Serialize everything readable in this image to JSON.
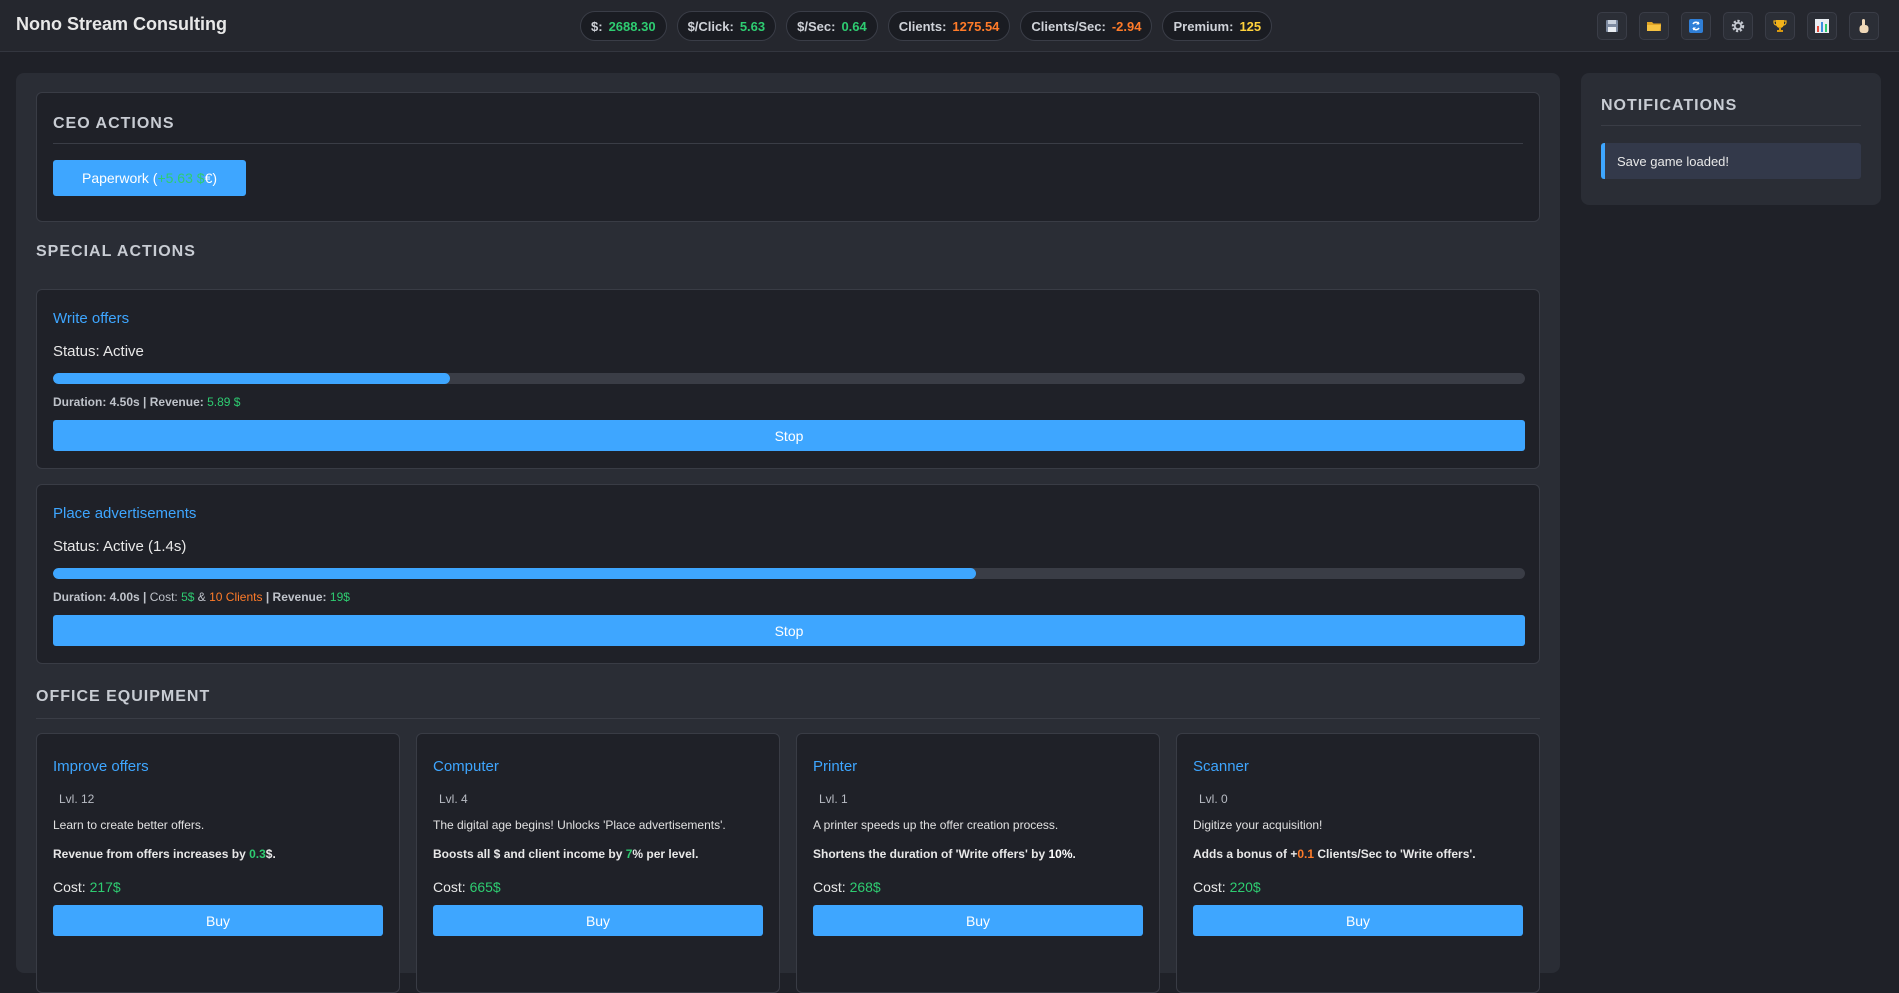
{
  "app": {
    "title": "Nono Stream Consulting"
  },
  "stats": [
    {
      "label": "$:",
      "value": "2688.30",
      "color": "#2ecc71"
    },
    {
      "label": "$/Click:",
      "value": "5.63",
      "color": "#2ecc71"
    },
    {
      "label": "$/Sec:",
      "value": "0.64",
      "color": "#2ecc71"
    },
    {
      "label": "Clients:",
      "value": "1275.54",
      "color": "#ff7b29"
    },
    {
      "label": "Clients/Sec:",
      "value": "-2.94",
      "color": "#ff7b29"
    },
    {
      "label": "Premium:",
      "value": "125",
      "color": "#ffd23c"
    }
  ],
  "toolbar": {
    "icons": [
      "save-icon",
      "load-folder-icon",
      "reset-icon",
      "settings-gear-icon",
      "trophy-icon",
      "stats-chart-icon",
      "pointer-hand-icon"
    ]
  },
  "ceo": {
    "title": "CEO ACTIONS",
    "paperwork_prefix": "Paperwork (",
    "paperwork_value": "+5.63 $",
    "paperwork_suffix": " €)"
  },
  "special": {
    "title": "SPECIAL ACTIONS",
    "actions": [
      {
        "name": "Write offers",
        "status": "Status: Active",
        "progress": 0.27,
        "duration_label": "Duration:",
        "duration": "4.50s",
        "sep": " | ",
        "revenue_label": "Revenue:",
        "revenue": "5.89 $",
        "button": "Stop"
      },
      {
        "name": "Place advertisements",
        "status": "Status: Active (1.4s)",
        "progress": 0.627,
        "duration_label": "Duration:",
        "duration": "4.00s",
        "sep": " | ",
        "cost_label": "Cost:",
        "cost_money": "5$",
        "amp": " & ",
        "cost_clients": "10 Clients",
        "sep2": " | ",
        "revenue_label": "Revenue:",
        "revenue": "19$",
        "button": "Stop"
      }
    ]
  },
  "office": {
    "title": "OFFICE EQUIPMENT",
    "items": [
      {
        "name": "Improve offers",
        "level": "Lvl. 12",
        "desc": "Learn to create better offers.",
        "effect_pre": "Revenue from offers increases by ",
        "effect_val": "0.3",
        "effect_post": "$.",
        "cost_label": "Cost: ",
        "cost": "217$",
        "button": "Buy"
      },
      {
        "name": "Computer",
        "level": "Lvl. 4",
        "desc": "The digital age begins! Unlocks 'Place advertisements'.",
        "effect_pre": "Boosts all $ and client income by ",
        "effect_val": "7",
        "effect_post": "% per level.",
        "cost_label": "Cost: ",
        "cost": "665$",
        "button": "Buy"
      },
      {
        "name": "Printer",
        "level": "Lvl. 1",
        "desc": "A printer speeds up the offer creation process.",
        "effect_pre": "Shortens the duration of 'Write offers' by ",
        "effect_val": "10%",
        "effect_post": ".",
        "cost_label": "Cost: ",
        "cost": "268$",
        "button": "Buy"
      },
      {
        "name": "Scanner",
        "level": "Lvl. 0",
        "desc": "Digitize your acquisition!",
        "effect_pre": "Adds a bonus of +",
        "effect_val": "0.1",
        "effect_post": " Clients/Sec to 'Write offers'.",
        "cost_label": "Cost: ",
        "cost": "220$",
        "button": "Buy"
      }
    ]
  },
  "notifications": {
    "title": "NOTIFICATIONS",
    "items": [
      "Save game loaded!"
    ]
  }
}
